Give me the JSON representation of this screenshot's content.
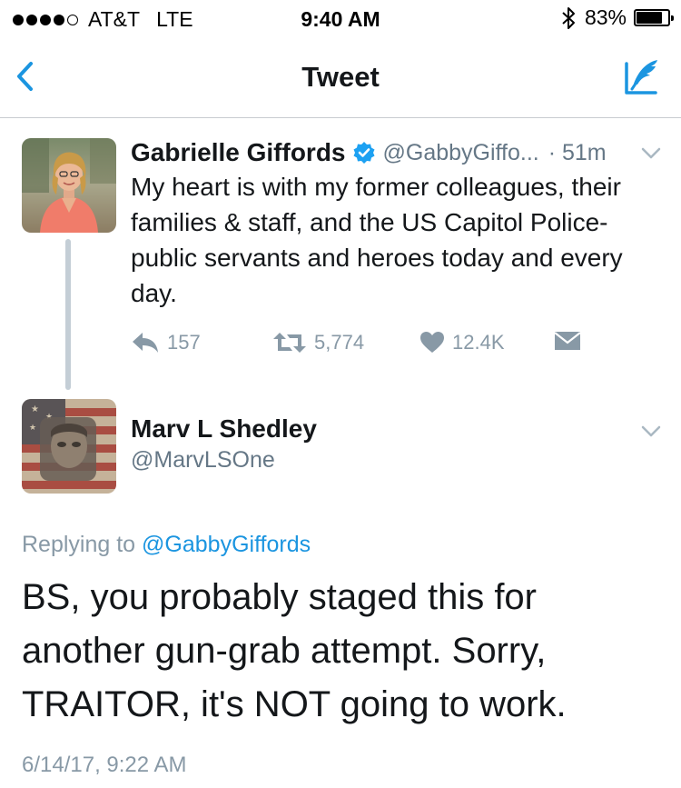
{
  "status_bar": {
    "carrier": "AT&T",
    "network": "LTE",
    "time": "9:40 AM",
    "battery_percent": "83%",
    "battery_level": 0.83
  },
  "nav": {
    "title": "Tweet",
    "accent_color": "#1b95e0"
  },
  "original_tweet": {
    "author_name": "Gabrielle Giffords",
    "handle": "@GabbyGiffo...",
    "time_ago": "· 51m",
    "text": "My heart is with my former colleagues, their families & staff, and the US Capitol Police- public servants and heroes today and every day.",
    "replies": "157",
    "retweets": "5,774",
    "likes": "12.4K"
  },
  "reply_tweet": {
    "author_name": "Marv L Shedley",
    "handle": "@MarvLSOne",
    "replying_prefix": "Replying to",
    "replying_to": "@GabbyGiffords",
    "text": "BS, you probably staged this for another gun-grab attempt.  Sorry, TRAITOR, it's NOT going to work.",
    "timestamp": "6/14/17, 9:22 AM"
  }
}
